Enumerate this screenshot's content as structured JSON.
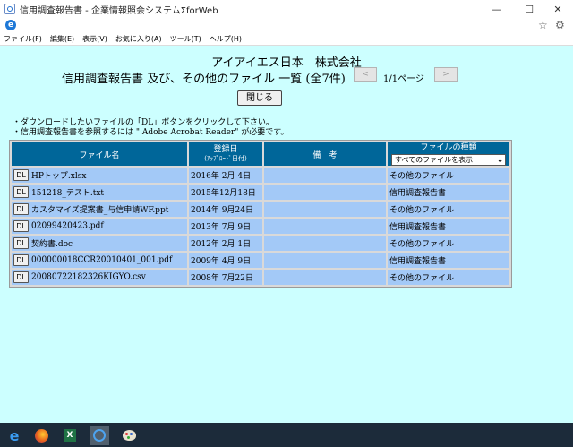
{
  "window": {
    "title": "信用調査報告書 - 企業情報照会システムΣforWeb",
    "controls": {
      "minimize": "—",
      "maximize": "☐",
      "close": "✕"
    }
  },
  "icons": {
    "app": "ie-page-icon",
    "favorites": "star-icon",
    "tools": "gear-icon"
  },
  "menu": [
    "ファイル(F)",
    "編集(E)",
    "表示(V)",
    "お気に入り(A)",
    "ツール(T)",
    "ヘルプ(H)"
  ],
  "page": {
    "company": "アイアイエス日本　株式会社",
    "title": "信用調査報告書 及び、その他のファイル 一覧 (全7件)",
    "prev": "<",
    "page_info": "1/1ページ",
    "next": ">",
    "close_button": "閉じる",
    "notes": [
      "・ダウンロードしたいファイルの「DL」ボタンをクリックして下さい。",
      "・信用調査報告書を参照するには \" Adobe Acrobat Reader\" が必要です。"
    ]
  },
  "table": {
    "headers": {
      "filename": "ファイル名",
      "registered": "登録日",
      "registered_sub": "(ｱｯﾌﾟﾛｰﾄﾞ日付)",
      "remarks": "備　考",
      "kind": "ファイルの種類",
      "kind_select": "すべてのファイルを表示"
    },
    "dl_label": "DL",
    "rows": [
      {
        "name": "HPトップ.xlsx",
        "date": "2016年 2月 4日",
        "remarks": "",
        "kind": "その他のファイル"
      },
      {
        "name": "151218_テスト.txt",
        "date": "2015年12月18日",
        "remarks": "",
        "kind": "信用調査報告書"
      },
      {
        "name": "カスタマイズ提案書_与信申請WF.ppt",
        "date": "2014年 9月24日",
        "remarks": "",
        "kind": "その他のファイル"
      },
      {
        "name": "02099420423.pdf",
        "date": "2013年 7月 9日",
        "remarks": "",
        "kind": "信用調査報告書"
      },
      {
        "name": "契約書.doc",
        "date": "2012年 2月 1日",
        "remarks": "",
        "kind": "その他のファイル"
      },
      {
        "name": "000000018CCR20010401_001.pdf",
        "date": "2009年 4月 9日",
        "remarks": "",
        "kind": "信用調査報告書"
      },
      {
        "name": "20080722182326KIGYO.csv",
        "date": "2008年 7月22日",
        "remarks": "",
        "kind": "その他のファイル"
      }
    ]
  },
  "taskbar": {
    "items": [
      "edge-icon",
      "firefox-icon",
      "excel-icon",
      "internet-explorer-icon",
      "paint-icon"
    ],
    "excel_letter": "X",
    "edge_letter": "e"
  }
}
